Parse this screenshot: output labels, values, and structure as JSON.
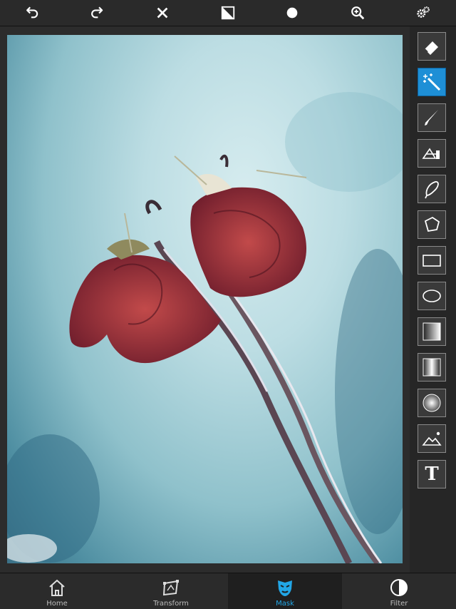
{
  "toolbar": {
    "undo_icon": "undo-icon",
    "redo_icon": "redo-icon",
    "clear_icon": "close-icon",
    "invert_icon": "invert-mask-icon",
    "brush_icon": "brush-dot-icon",
    "zoom_icon": "zoom-in-icon",
    "settings_icon": "gears-icon"
  },
  "side_tools": [
    {
      "name": "eraser-tool",
      "icon": "eraser-icon",
      "active": false
    },
    {
      "name": "magic-wand-tool",
      "icon": "magic-wand-icon",
      "active": true
    },
    {
      "name": "brush-tool",
      "icon": "brush-icon",
      "active": false
    },
    {
      "name": "edge-tool",
      "icon": "edge-detect-icon",
      "active": false
    },
    {
      "name": "lasso-tool",
      "icon": "lasso-icon",
      "active": false
    },
    {
      "name": "polygon-tool",
      "icon": "polygon-icon",
      "active": false
    },
    {
      "name": "rectangle-tool",
      "icon": "rectangle-icon",
      "active": false
    },
    {
      "name": "ellipse-tool",
      "icon": "ellipse-icon",
      "active": false
    },
    {
      "name": "linear-gradient-tool",
      "icon": "linear-gradient-icon",
      "active": false
    },
    {
      "name": "mirror-gradient-tool",
      "icon": "mirror-gradient-icon",
      "active": false
    },
    {
      "name": "radial-gradient-tool",
      "icon": "radial-gradient-icon",
      "active": false
    },
    {
      "name": "image-mask-tool",
      "icon": "image-icon",
      "active": false
    },
    {
      "name": "text-tool",
      "icon": "text-icon",
      "active": false
    }
  ],
  "text_tool_glyph": "T",
  "tabs": {
    "home": "Home",
    "transform": "Transform",
    "mask": "Mask",
    "filter": "Filter"
  },
  "colors": {
    "accent": "#22a6e6",
    "active_tool": "#1e8fd6"
  }
}
